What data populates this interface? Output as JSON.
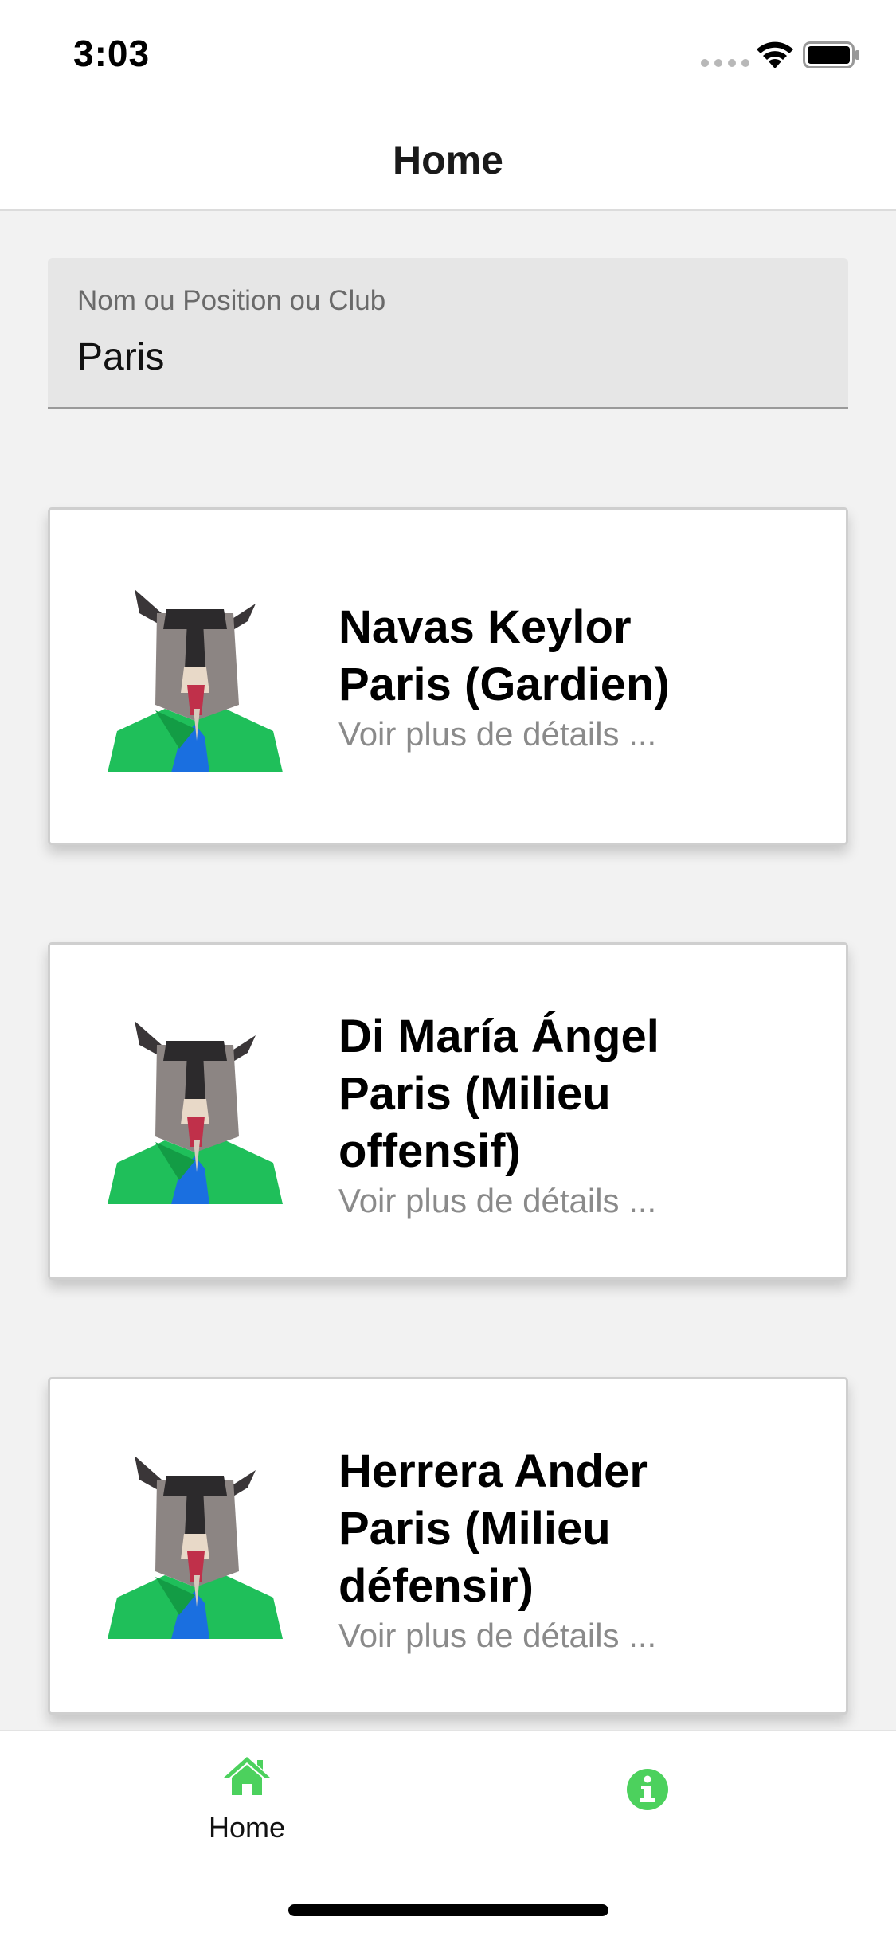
{
  "status_bar": {
    "time": "3:03"
  },
  "nav": {
    "title": "Home"
  },
  "search": {
    "label": "Nom ou Position ou Club",
    "value": "Paris"
  },
  "players": [
    {
      "name_line1": "Navas Keylor",
      "name_line2": "Paris (Gardien)",
      "name_line3": "",
      "details": "Voir plus de détails ..."
    },
    {
      "name_line1": "Di María Ángel",
      "name_line2": "Paris (Milieu",
      "name_line3": "offensif)",
      "details": "Voir plus de détails ..."
    },
    {
      "name_line1": "Herrera Ander",
      "name_line2": "Paris (Milieu",
      "name_line3": "défensir)",
      "details": "Voir plus de détails ..."
    }
  ],
  "tabs": [
    {
      "label": "Home",
      "icon": "home-icon",
      "active": true
    },
    {
      "label": "",
      "icon": "info-icon",
      "active": false
    }
  ],
  "colors": {
    "accent": "#4cd15d",
    "jersey": "#1fbf5a",
    "goat_grey": "#8c8583"
  }
}
